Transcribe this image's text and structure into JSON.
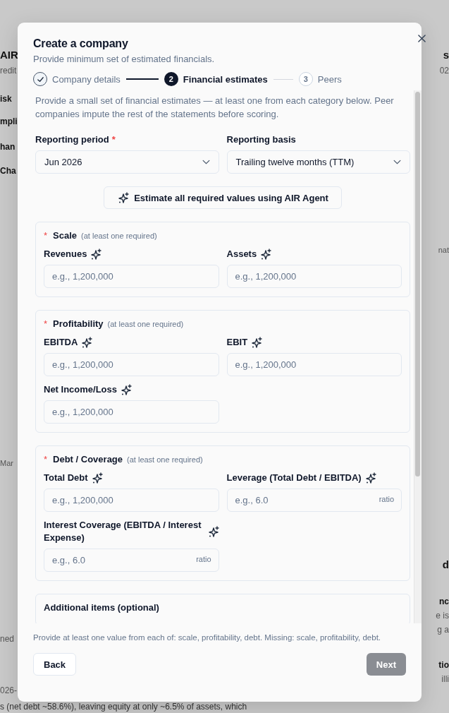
{
  "background": {
    "left_fragments": [
      {
        "text": "AIR",
        "kind": "title"
      },
      {
        "text": "redit",
        "kind": "muted"
      },
      {
        "text": "isk",
        "kind": "label"
      },
      {
        "text": "mpli",
        "kind": "label"
      },
      {
        "text": "han",
        "kind": "label"
      },
      {
        "text": "Cha",
        "kind": "label"
      },
      {
        "text": "Mar",
        "kind": "axis"
      },
      {
        "text": "ned",
        "kind": "muted"
      },
      {
        "text": "026-",
        "kind": "muted"
      }
    ],
    "right_fragments": [
      {
        "text": "s",
        "kind": "title"
      },
      {
        "text": "02",
        "kind": "muted"
      },
      {
        "text": "nat",
        "kind": "axis"
      },
      {
        "text": "d",
        "kind": "title"
      },
      {
        "text": "nc",
        "kind": "label"
      },
      {
        "text": "e is",
        "kind": "muted"
      },
      {
        "text": "g a",
        "kind": "muted"
      },
      {
        "text": "tio",
        "kind": "label"
      },
      {
        "text": "illi",
        "kind": "muted"
      }
    ],
    "bottom_text": "s (net debt ~58.6%), leaving equity at only ~6.5% of assets, which"
  },
  "dialog": {
    "title": "Create a company",
    "subtitle": "Provide minimum set of estimated financials.",
    "steps": [
      {
        "label": "Company details",
        "done": true,
        "selected": false
      },
      {
        "number": "2",
        "label": "Financial estimates",
        "done": false,
        "selected": true
      },
      {
        "number": "3",
        "label": "Peers",
        "done": false,
        "selected": false
      }
    ],
    "intro": "Provide a small set of financial estimates — at least one from each category below. Peer companies impute the rest of the statements before scoring.",
    "selects": [
      {
        "label": "Reporting period",
        "required_mark": "*",
        "value": "Jun 2026"
      },
      {
        "label": "Reporting basis",
        "value": "Trailing twelve months (TTM)"
      }
    ],
    "agent_button": "Estimate all required values using AIR Agent",
    "sections": [
      {
        "title": "Scale",
        "hint": "(at least one required)",
        "required_mark": "*",
        "fields": [
          {
            "label": "Revenues",
            "placeholder": "e.g., 1,200,000",
            "ai": true
          },
          {
            "label": "Assets",
            "placeholder": "e.g., 1,200,000",
            "ai": true
          }
        ]
      },
      {
        "title": "Profitability",
        "hint": "(at least one required)",
        "required_mark": "*",
        "fields": [
          {
            "label": "EBITDA",
            "placeholder": "e.g., 1,200,000",
            "ai": true
          },
          {
            "label": "EBIT",
            "placeholder": "e.g., 1,200,000",
            "ai": true
          },
          {
            "label": "Net Income/Loss",
            "placeholder": "e.g., 1,200,000",
            "ai": true
          }
        ]
      },
      {
        "title": "Debt / Coverage",
        "hint": "(at least one required)",
        "required_mark": "*",
        "fields": [
          {
            "label": "Total Debt",
            "placeholder": "e.g., 1,200,000",
            "ai": true
          },
          {
            "label": "Leverage (Total Debt / EBITDA)",
            "placeholder": "e.g., 6.0",
            "unit": "ratio",
            "ai": true
          },
          {
            "label": "Interest Coverage (EBITDA / Interest Expense)",
            "placeholder": "e.g., 6.0",
            "unit": "ratio",
            "ai": true
          }
        ]
      },
      {
        "title": "Additional items (optional)"
      }
    ],
    "footer_note": "Provide at least one value from each of: scale, profitability, debt. Missing: scale, profitability, debt.",
    "back_button": "Back",
    "next_button": {
      "label": "Next",
      "disabled": true
    }
  }
}
